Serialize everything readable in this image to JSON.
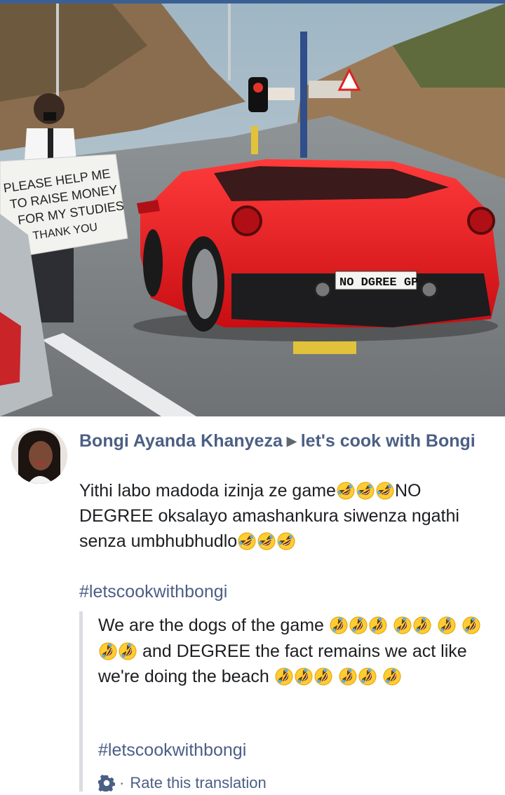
{
  "photo": {
    "alt": "Red sports car next to man with sign",
    "sign_text": "PLEASE HELP ME TO RAISE MONEY FOR MY STUDIES THANK YOU",
    "plate_text": "NO DGREE GP"
  },
  "post": {
    "author": "Bongi Ayanda Khanyeza",
    "separator": "▶",
    "group": "let's cook with Bongi",
    "message_part1": "Yithi labo madoda izinja ze game",
    "message_part2": "NO DEGREE oksalayo amashankura siwenza ngathi senza umbhubhudlo",
    "hashtag": "#letscookwithbongi",
    "translation": {
      "part1": "We are the dogs of the game",
      "part2": "and DEGREE the fact remains we act like we're doing the beach",
      "hashtag": "#letscookwithbongi",
      "rate_label": "Rate this translation",
      "rate_separator": "·"
    },
    "emoji_name": "rolling-on-the-floor-laughing"
  },
  "colors": {
    "link": "#4b5f85",
    "text": "#1c1e21",
    "quote_border": "#dadde1",
    "topbar": "#3b5f93"
  }
}
